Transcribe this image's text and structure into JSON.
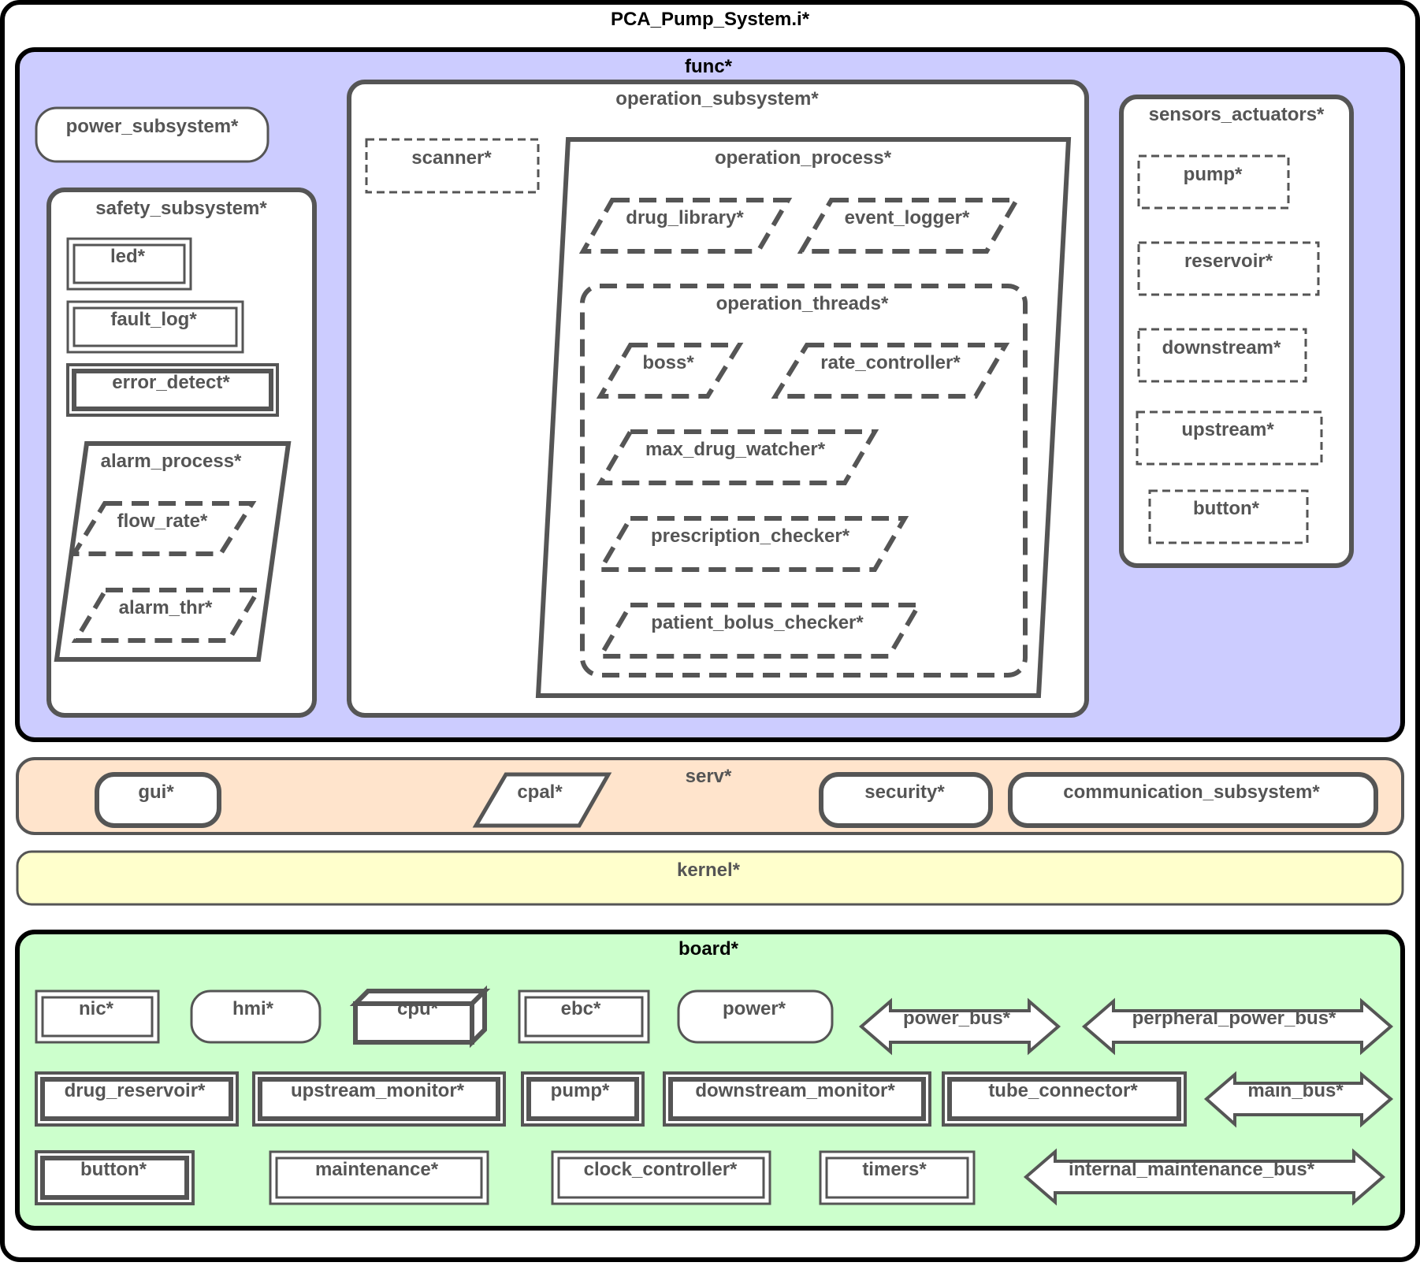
{
  "title": "PCA_Pump_System.i*",
  "colors": {
    "func_fill": "#ccccff",
    "serv_fill": "#ffe4cc",
    "kernel_fill": "#ffffcc",
    "board_fill": "#ccffcc",
    "stroke": "#555555",
    "frame": "#000000"
  },
  "func": {
    "label": "func*",
    "power_subsystem": "power_subsystem*",
    "safety_subsystem": {
      "label": "safety_subsystem*",
      "led": "led*",
      "fault_log": "fault_log*",
      "error_detect": "error_detect*",
      "alarm_process": {
        "label": "alarm_process*",
        "flow_rate": "flow_rate*",
        "alarm_thr": "alarm_thr*"
      }
    },
    "operation_subsystem": {
      "label": "operation_subsystem*",
      "scanner": "scanner*",
      "operation_process": {
        "label": "operation_process*",
        "drug_library": "drug_library*",
        "event_logger": "event_logger*",
        "operation_threads": {
          "label": "operation_threads*",
          "boss": "boss*",
          "rate_controller": "rate_controller*",
          "max_drug_watcher": "max_drug_watcher*",
          "prescription_checker": "prescription_checker*",
          "patient_bolus_checker": "patient_bolus_checker*"
        }
      }
    },
    "sensors_actuators": {
      "label": "sensors_actuators*",
      "pump": "pump*",
      "reservoir": "reservoir*",
      "downstream": "downstream*",
      "upstream": "upstream*",
      "button": "button*"
    }
  },
  "serv": {
    "label": "serv*",
    "gui": "gui*",
    "cpal": "cpal*",
    "security": "security*",
    "communication_subsystem": "communication_subsystem*"
  },
  "kernel": {
    "label": "kernel*"
  },
  "board": {
    "label": "board*",
    "nic": "nic*",
    "hmi": "hmi*",
    "cpu": "cpu*",
    "ebc": "ebc*",
    "power": "power*",
    "power_bus": "power_bus*",
    "perpheral_power_bus": "perpheral_power_bus*",
    "drug_reservoir": "drug_reservoir*",
    "upstream_monitor": "upstream_monitor*",
    "pump": "pump*",
    "downstream_monitor": "downstream_monitor*",
    "tube_connector": "tube_connector*",
    "main_bus": "main_bus*",
    "button": "button*",
    "maintenance": "maintenance*",
    "clock_controller": "clock_controller*",
    "timers": "timers*",
    "internal_maintenance_bus": "internal_maintenance_bus*"
  }
}
